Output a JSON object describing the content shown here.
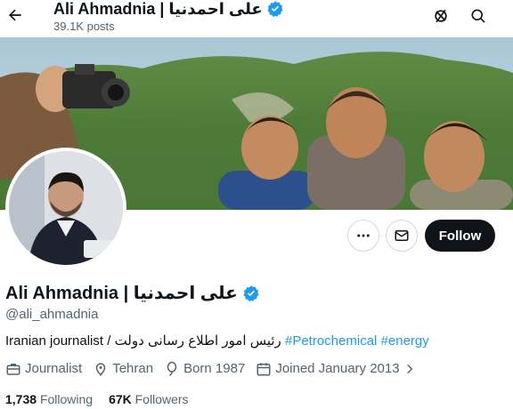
{
  "header": {
    "name": "Ali Ahmadnia | علی احمدنیا",
    "posts": "39.1K posts"
  },
  "profile": {
    "name": "Ali Ahmadnia | علی احمدنیا",
    "handle": "@ali_ahmadnia",
    "bio_text": "Iranian journalist / رئیس امور اطلاع رسانی دولت",
    "bio_tags": [
      "#Petrochemical",
      "#energy"
    ],
    "profession": "Journalist",
    "location": "Tehran",
    "born": "Born 1987",
    "joined": "Joined January 2013"
  },
  "stats": {
    "following_count": "1,738",
    "following_label": "Following",
    "followers_count": "67K",
    "followers_label": "Followers"
  },
  "actions": {
    "follow_label": "Follow"
  },
  "icons": {
    "back": "arrow-left-icon",
    "grok": "grok-icon",
    "search": "search-icon",
    "more": "more-horizontal-icon",
    "message": "mail-icon",
    "verified": "verified-badge-icon",
    "profession": "briefcase-icon",
    "location": "location-pin-icon",
    "born": "balloon-icon",
    "joined": "calendar-icon",
    "chevron": "chevron-right-icon"
  },
  "colors": {
    "accent": "#1d9bf0",
    "text": "#0f1419",
    "muted": "#536471",
    "follow_bg": "#0f1419"
  }
}
